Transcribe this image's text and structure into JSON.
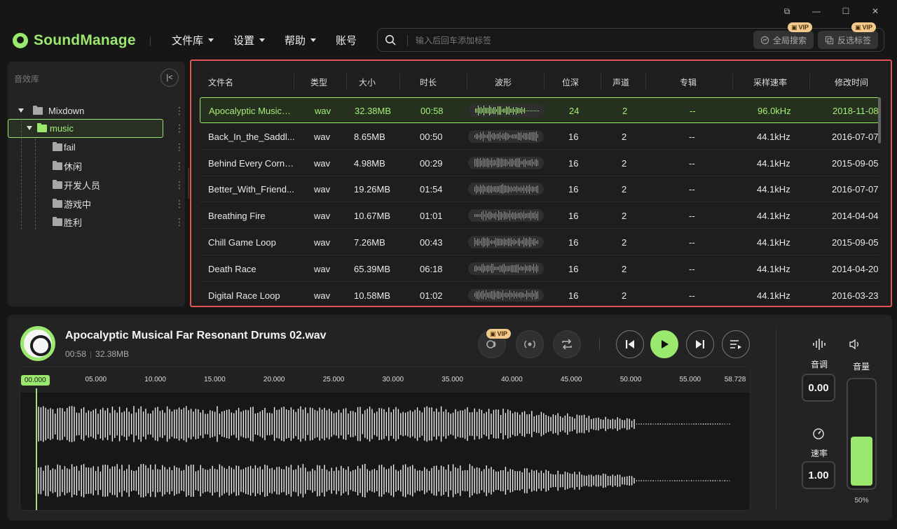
{
  "window": {
    "restore": "⧉",
    "minimize": "—",
    "maximize": "☐",
    "close": "✕"
  },
  "app": {
    "name": "SoundManage"
  },
  "menu": [
    {
      "label": "文件库",
      "dropdown": true
    },
    {
      "label": "设置",
      "dropdown": true
    },
    {
      "label": "帮助",
      "dropdown": true
    },
    {
      "label": "账号",
      "dropdown": false
    }
  ],
  "search": {
    "placeholder": "输入后回车添加标签",
    "global_search": "全局搜索",
    "invert_tags": "反选标签",
    "vip": "VIP"
  },
  "sidebar": {
    "title": "音效库",
    "collapse": "|<",
    "tree": [
      {
        "label": "Mixdown",
        "level": 0,
        "expanded": true
      },
      {
        "label": "music",
        "level": 1,
        "expanded": true,
        "selected": true
      },
      {
        "label": "fail",
        "level": 2
      },
      {
        "label": "休闲",
        "level": 2
      },
      {
        "label": "开发人员",
        "level": 2
      },
      {
        "label": "游戏中",
        "level": 2
      },
      {
        "label": "胜利",
        "level": 2
      }
    ]
  },
  "table": {
    "columns": [
      "文件名",
      "类型",
      "大小",
      "时长",
      "波形",
      "位深",
      "声道",
      "专辑",
      "采样速率",
      "修改时间"
    ],
    "rows": [
      {
        "name": "Apocalyptic Musical...",
        "type": "wav",
        "size": "32.38MB",
        "duration": "00:58",
        "depth": "24",
        "channels": "2",
        "album": "--",
        "rate": "96.0kHz",
        "modified": "2018-11-08",
        "active": true
      },
      {
        "name": "Back_In_the_Saddl...",
        "type": "wav",
        "size": "8.65MB",
        "duration": "00:50",
        "depth": "16",
        "channels": "2",
        "album": "--",
        "rate": "44.1kHz",
        "modified": "2016-07-07"
      },
      {
        "name": "Behind Every Corne...",
        "type": "wav",
        "size": "4.98MB",
        "duration": "00:29",
        "depth": "16",
        "channels": "2",
        "album": "--",
        "rate": "44.1kHz",
        "modified": "2015-09-05"
      },
      {
        "name": "Better_With_Friend...",
        "type": "wav",
        "size": "19.26MB",
        "duration": "01:54",
        "depth": "16",
        "channels": "2",
        "album": "--",
        "rate": "44.1kHz",
        "modified": "2016-07-07"
      },
      {
        "name": "Breathing Fire",
        "type": "wav",
        "size": "10.67MB",
        "duration": "01:01",
        "depth": "16",
        "channels": "2",
        "album": "--",
        "rate": "44.1kHz",
        "modified": "2014-04-04"
      },
      {
        "name": "Chill Game Loop",
        "type": "wav",
        "size": "7.26MB",
        "duration": "00:43",
        "depth": "16",
        "channels": "2",
        "album": "--",
        "rate": "44.1kHz",
        "modified": "2015-09-05"
      },
      {
        "name": "Death Race",
        "type": "wav",
        "size": "65.39MB",
        "duration": "06:18",
        "depth": "16",
        "channels": "2",
        "album": "--",
        "rate": "44.1kHz",
        "modified": "2014-04-20"
      },
      {
        "name": "Digital Race Loop",
        "type": "wav",
        "size": "10.58MB",
        "duration": "01:02",
        "depth": "16",
        "channels": "2",
        "album": "--",
        "rate": "44.1kHz",
        "modified": "2016-03-23"
      }
    ]
  },
  "player": {
    "title": "Apocalyptic Musical Far Resonant Drums 02.wav",
    "duration": "00:58",
    "size": "32.38MB",
    "vip": "VIP",
    "timeline": [
      "00.000",
      "05.000",
      "10.000",
      "15.000",
      "20.000",
      "25.000",
      "30.000",
      "35.000",
      "40.000",
      "45.000",
      "50.000",
      "55.000",
      "58.728"
    ],
    "pitch_label": "音调",
    "pitch_value": "0.00",
    "speed_label": "速率",
    "speed_value": "1.00",
    "volume_label": "音量",
    "volume_pct": "50%",
    "volume_level": 0.5
  },
  "colors": {
    "accent": "#9be86e",
    "highlight_border": "#e25555",
    "vip": "#f2c98a"
  }
}
